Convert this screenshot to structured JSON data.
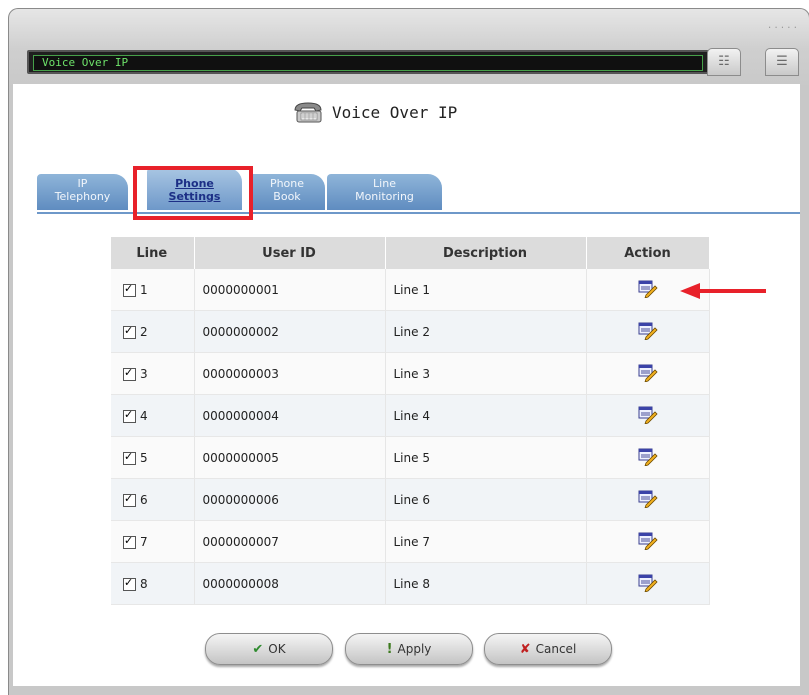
{
  "window": {
    "title": "Voice Over IP",
    "grip_text": "....."
  },
  "heading": {
    "title": "Voice Over IP",
    "icon": "phone-icon"
  },
  "tabs": [
    {
      "line1": "IP",
      "line2": "Telephony",
      "active": false
    },
    {
      "line1": "Phone",
      "line2": "Settings",
      "active": true
    },
    {
      "line1": "Phone",
      "line2": "Book",
      "active": false
    },
    {
      "line1": "Line",
      "line2": "Monitoring",
      "active": false
    }
  ],
  "table": {
    "headers": [
      "Line",
      "User ID",
      "Description",
      "Action"
    ],
    "rows": [
      {
        "line": "1",
        "checked": true,
        "user_id": "0000000001",
        "description": "Line 1",
        "action": "edit-icon"
      },
      {
        "line": "2",
        "checked": true,
        "user_id": "0000000002",
        "description": "Line 2",
        "action": "edit-icon"
      },
      {
        "line": "3",
        "checked": true,
        "user_id": "0000000003",
        "description": "Line 3",
        "action": "edit-icon"
      },
      {
        "line": "4",
        "checked": true,
        "user_id": "0000000004",
        "description": "Line 4",
        "action": "edit-icon"
      },
      {
        "line": "5",
        "checked": true,
        "user_id": "0000000005",
        "description": "Line 5",
        "action": "edit-icon"
      },
      {
        "line": "6",
        "checked": true,
        "user_id": "0000000006",
        "description": "Line 6",
        "action": "edit-icon"
      },
      {
        "line": "7",
        "checked": true,
        "user_id": "0000000007",
        "description": "Line 7",
        "action": "edit-icon"
      },
      {
        "line": "8",
        "checked": true,
        "user_id": "0000000008",
        "description": "Line 8",
        "action": "edit-icon"
      }
    ]
  },
  "buttons": {
    "ok": {
      "label": "OK",
      "icon": "check-icon"
    },
    "apply": {
      "label": "Apply",
      "icon": "exclamation-icon"
    },
    "cancel": {
      "label": "Cancel",
      "icon": "x-icon"
    }
  },
  "colors": {
    "highlight": "#e8212a",
    "title_text": "#6ee36a",
    "tab_blue": "#6e98c9",
    "active_tab_text": "#1c2f86"
  }
}
